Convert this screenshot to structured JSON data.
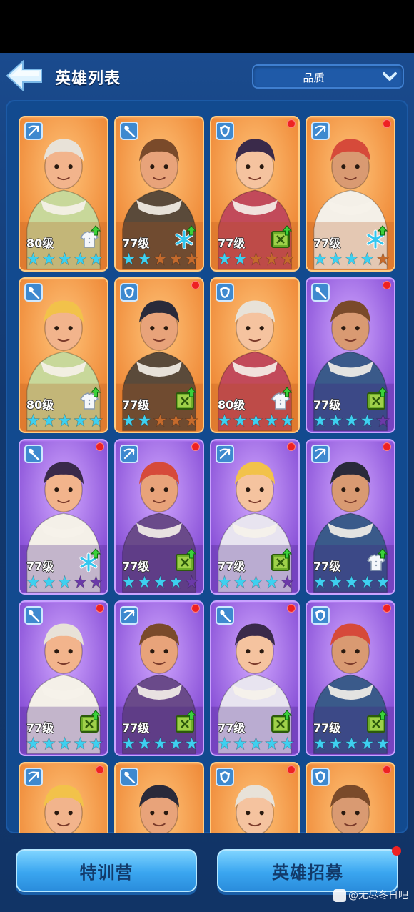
{
  "header": {
    "title": "英雄列表",
    "quality_filter": "品质"
  },
  "colors": {
    "orange_card": "#f08a3a",
    "purple_card": "#8c54da",
    "star_lit": "#3ed0f0",
    "star_dim_orange": "#c46a2c",
    "star_dim_purple": "#6b3aa8",
    "notification": "#ee2222"
  },
  "heroes": [
    {
      "level": "80级",
      "rarity": "orange",
      "class_icon": "crossbow-icon",
      "upgrade_icon": "shirt-upgrade-icon",
      "stars_lit": 5,
      "notify": false
    },
    {
      "level": "77级",
      "rarity": "orange",
      "class_icon": "shovel-icon",
      "upgrade_icon": "snowflake-upgrade-icon",
      "stars_lit": 2,
      "notify": false
    },
    {
      "level": "77级",
      "rarity": "orange",
      "class_icon": "shield-icon",
      "upgrade_icon": "book-upgrade-icon",
      "stars_lit": 1.5,
      "notify": true
    },
    {
      "level": "77级",
      "rarity": "orange",
      "class_icon": "crossbow-icon",
      "upgrade_icon": "snowflake-upgrade-icon",
      "stars_lit": 3.5,
      "notify": true
    },
    {
      "level": "80级",
      "rarity": "orange",
      "class_icon": "shovel-icon",
      "upgrade_icon": "shirt-upgrade-icon",
      "stars_lit": 5,
      "notify": false
    },
    {
      "level": "77级",
      "rarity": "orange",
      "class_icon": "shield-icon",
      "upgrade_icon": "book-upgrade-icon",
      "stars_lit": 2,
      "notify": true
    },
    {
      "level": "80级",
      "rarity": "orange",
      "class_icon": "shield-icon",
      "upgrade_icon": "shirt-upgrade-icon",
      "stars_lit": 5,
      "notify": false
    },
    {
      "level": "77级",
      "rarity": "purple",
      "class_icon": "shovel-icon",
      "upgrade_icon": "book-upgrade-icon",
      "stars_lit": 4,
      "notify": true
    },
    {
      "level": "77级",
      "rarity": "purple",
      "class_icon": "shovel-icon",
      "upgrade_icon": "snowflake-upgrade-icon",
      "stars_lit": 3,
      "notify": true
    },
    {
      "level": "77级",
      "rarity": "purple",
      "class_icon": "crossbow-icon",
      "upgrade_icon": "book-upgrade-icon",
      "stars_lit": 4,
      "notify": true
    },
    {
      "level": "77级",
      "rarity": "purple",
      "class_icon": "crossbow-icon",
      "upgrade_icon": "book-upgrade-icon",
      "stars_lit": 3.5,
      "notify": true
    },
    {
      "level": "77级",
      "rarity": "purple",
      "class_icon": "crossbow-icon",
      "upgrade_icon": "shirt-upgrade-icon",
      "stars_lit": 5,
      "notify": true
    },
    {
      "level": "77级",
      "rarity": "purple",
      "class_icon": "shovel-icon",
      "upgrade_icon": "book-upgrade-icon",
      "stars_lit": 5,
      "notify": true
    },
    {
      "level": "77级",
      "rarity": "purple",
      "class_icon": "crossbow-icon",
      "upgrade_icon": "book-upgrade-icon",
      "stars_lit": 5,
      "notify": true
    },
    {
      "level": "77级",
      "rarity": "purple",
      "class_icon": "shovel-icon",
      "upgrade_icon": "book-upgrade-icon",
      "stars_lit": 5,
      "notify": true
    },
    {
      "level": "77级",
      "rarity": "purple",
      "class_icon": "shield-icon",
      "upgrade_icon": "book-upgrade-icon",
      "stars_lit": 5,
      "notify": true
    },
    {
      "level": "",
      "rarity": "orange",
      "class_icon": "crossbow-icon",
      "upgrade_icon": "",
      "stars_lit": 0,
      "notify": true
    },
    {
      "level": "",
      "rarity": "orange",
      "class_icon": "shovel-icon",
      "upgrade_icon": "",
      "stars_lit": 0,
      "notify": false
    },
    {
      "level": "",
      "rarity": "orange",
      "class_icon": "shield-icon",
      "upgrade_icon": "",
      "stars_lit": 0,
      "notify": true
    },
    {
      "level": "",
      "rarity": "orange",
      "class_icon": "shield-icon",
      "upgrade_icon": "",
      "stars_lit": 0,
      "notify": true
    }
  ],
  "bottom": {
    "training_camp": "特训营",
    "hero_recruit": "英雄招募"
  },
  "watermark": "@无尽冬日吧"
}
